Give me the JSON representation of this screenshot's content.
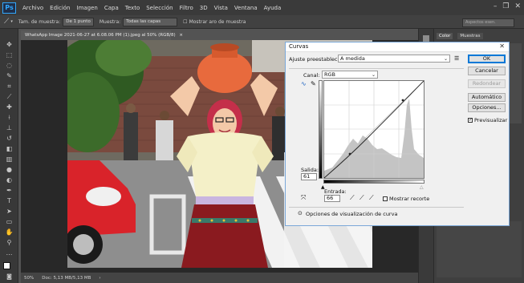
{
  "app": {
    "logo": "Ps"
  },
  "menu": [
    "Archivo",
    "Edición",
    "Imagen",
    "Capa",
    "Texto",
    "Selección",
    "Filtro",
    "3D",
    "Vista",
    "Ventana",
    "Ayuda"
  ],
  "options_bar": {
    "sample_size_label": "Tam. de muestra:",
    "sample_size_value": "De 1 punto",
    "sample_label": "Muestra:",
    "sample_value": "Todas las capas",
    "show_ring_label": "Mostrar aro de muestra",
    "workspace_placeholder": "Aspectos esen."
  },
  "document": {
    "tab_title": "WhatsApp Image 2021-06-27 at 6.08.06 PM (1).jpeg al 50% (RGB/8)",
    "zoom": "50%",
    "doc_size": "Doc: 5,13 MB/5,13 MB"
  },
  "right_dock": {
    "tabs": [
      "Color",
      "Muestras"
    ]
  },
  "curves": {
    "title": "Curvas",
    "preset_label": "Ajuste preestablecido:",
    "preset_value": "A medida",
    "channel_label": "Canal:",
    "channel_value": "RGB",
    "output_label": "Salida:",
    "output_value": "61",
    "input_label": "Entrada:",
    "input_value": "66",
    "show_clipping_label": "Mostrar recorte",
    "display_options_label": "Opciones de visualización de curva",
    "buttons": {
      "ok": "OK",
      "cancel": "Cancelar",
      "smooth": "Redondear",
      "auto": "Automático",
      "options": "Opciones..."
    },
    "preview_label": "Previsualizar",
    "preview_checked": true,
    "show_clipping_checked": false
  },
  "icons": {
    "menu_dropdown": "hamburger-icon",
    "close": "close-icon",
    "eyedropper": "eyedropper-icon"
  }
}
